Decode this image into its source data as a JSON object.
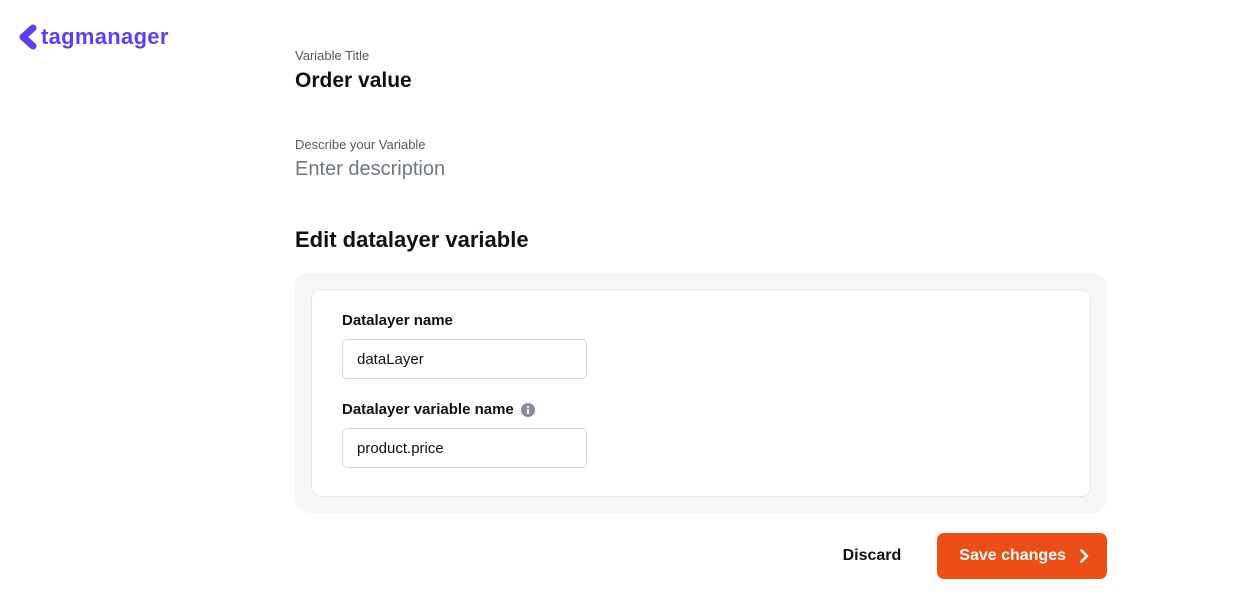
{
  "logo": {
    "text": "tagmanager"
  },
  "form": {
    "titleLabel": "Variable Title",
    "titleValue": "Order value",
    "descLabel": "Describe your Variable",
    "descPlaceholder": "Enter description"
  },
  "section": {
    "heading": "Edit datalayer variable",
    "datalayerNameLabel": "Datalayer name",
    "datalayerNameValue": "dataLayer",
    "variableNameLabel": "Datalayer variable name",
    "variableNameValue": "product.price"
  },
  "actions": {
    "discard": "Discard",
    "save": "Save changes"
  }
}
